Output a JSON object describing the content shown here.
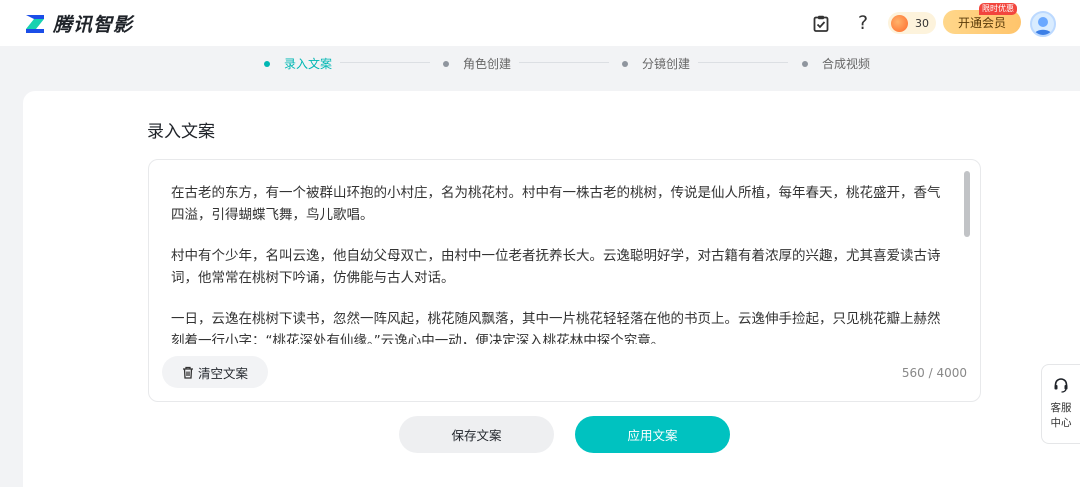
{
  "header": {
    "brand": "腾讯智影",
    "coin_count": "30",
    "vip_label": "开通会员",
    "vip_badge": "限时优惠"
  },
  "steps": [
    {
      "label": "录入文案",
      "active": true
    },
    {
      "label": "角色创建",
      "active": false
    },
    {
      "label": "分镜创建",
      "active": false
    },
    {
      "label": "合成视频",
      "active": false
    }
  ],
  "main": {
    "title": "录入文案",
    "paragraphs": [
      "在古老的东方，有一个被群山环抱的小村庄，名为桃花村。村中有一株古老的桃树，传说是仙人所植，每年春天，桃花盛开，香气四溢，引得蝴蝶飞舞，鸟儿歌唱。",
      "村中有个少年，名叫云逸，他自幼父母双亡，由村中一位老者抚养长大。云逸聪明好学，对古籍有着浓厚的兴趣，尤其喜爱读古诗词，他常常在桃树下吟诵，仿佛能与古人对话。",
      "一日，云逸在桃树下读书，忽然一阵风起，桃花随风飘落，其中一片桃花轻轻落在他的书页上。云逸伸手捡起，只见桃花瓣上赫然刻着一行小字：“桃花深处有仙缘。”云逸心中一动，便决定深入桃花林中探个究竟。"
    ],
    "clear_label": "清空文案",
    "counter": "560 / 4000",
    "save_label": "保存文案",
    "apply_label": "应用文案"
  },
  "service": {
    "label": "客服中心"
  },
  "colors": {
    "accent": "#00c2c0",
    "step_active": "#00b7b3"
  }
}
